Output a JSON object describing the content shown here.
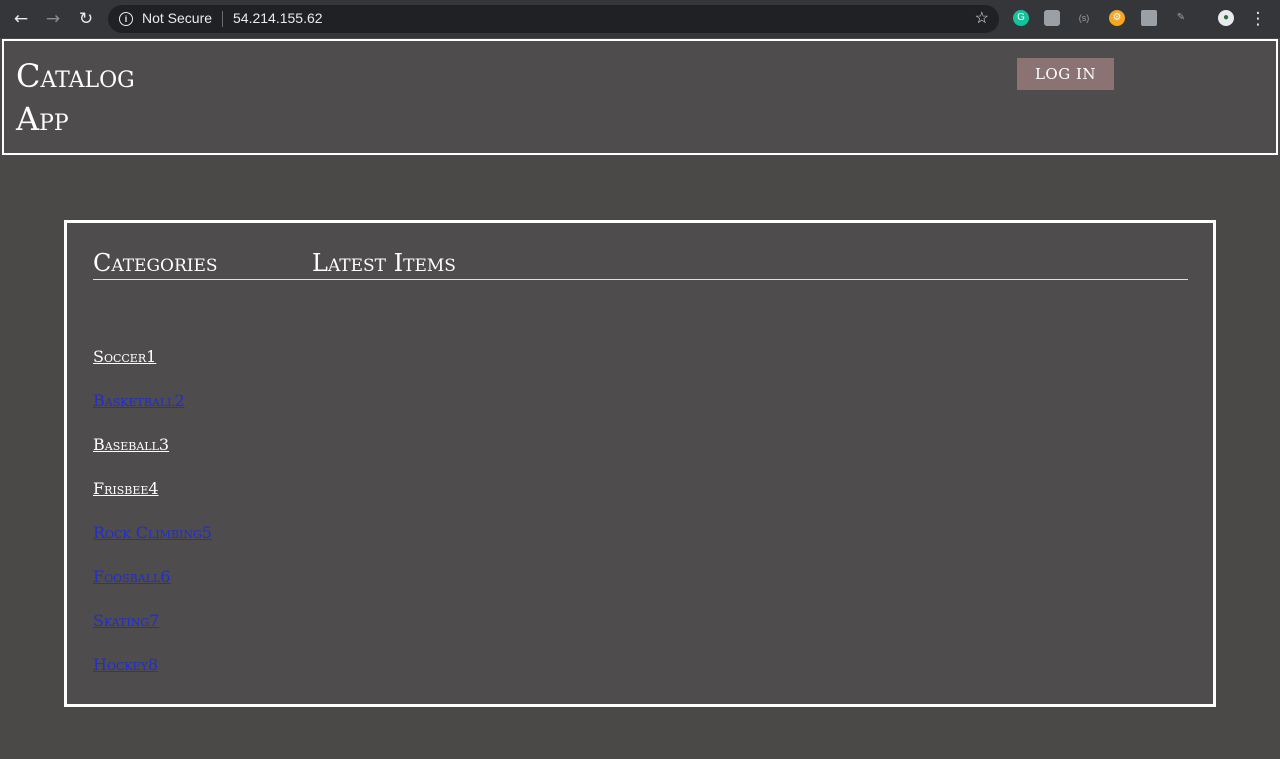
{
  "browser": {
    "security_label": "Not Secure",
    "url": "54.214.155.62"
  },
  "header": {
    "title": "Catalog App",
    "login_label": "LOG IN"
  },
  "main": {
    "categories_heading": "Categories",
    "latest_heading": "Latest Items",
    "categories": [
      {
        "label": "Soccer1",
        "visited": true
      },
      {
        "label": "Basketball2",
        "visited": false
      },
      {
        "label": "Baseball3",
        "visited": true
      },
      {
        "label": "Frisbee4",
        "visited": true
      },
      {
        "label": "Rock Climbing5",
        "visited": false
      },
      {
        "label": "Foosball6",
        "visited": false
      },
      {
        "label": "Skating7",
        "visited": false
      },
      {
        "label": "Hockey8",
        "visited": false
      }
    ]
  },
  "colors": {
    "page_bg": "#4a4948",
    "panel_bg": "#4e4c4d",
    "login_bg": "#8c7373",
    "visited_link": "#ffffff",
    "unvisited_link": "#1f2dd1"
  }
}
